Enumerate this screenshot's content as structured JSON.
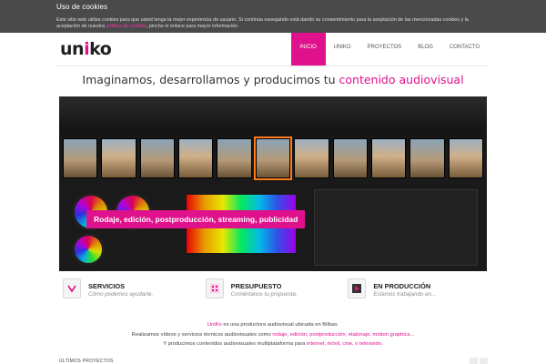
{
  "cookie": {
    "title": "Uso de cookies",
    "text_before": "Este sitio web utiliza cookies para que usted tenga la mejor experiencia de usuario. Si continúa navegando está dando su consentimiento para la aceptación de las mencionadas cookies y la aceptación de nuestra ",
    "link": "política de cookies",
    "text_after": ", pinche el enlace para mayor información."
  },
  "header": {
    "logo_pre": "un",
    "logo_i": "i",
    "logo_post": "ko",
    "nav": [
      "INICIO",
      "UNIKO",
      "PROYECTOS",
      "BLOG",
      "CONTACTO"
    ]
  },
  "tagline": {
    "main": "Imaginamos, desarrollamos y producimos tu ",
    "highlight": "contenido audiovisual"
  },
  "hero": {
    "caption": "Rodaje, edición, postproducción, streaming, publicidad"
  },
  "services": [
    {
      "title": "SERVICIOS",
      "subtitle": "Cómo podemos ayudarte.",
      "icon": "tag-icon"
    },
    {
      "title": "PRESUPUESTO",
      "subtitle": "Coméntanos tu propuesta.",
      "icon": "calculator-icon"
    },
    {
      "title": "EN PRODUCCIÓN",
      "subtitle": "Estamos trabajando en...",
      "icon": "film-icon"
    }
  ],
  "about": {
    "l1_brand": "UniKo",
    "l1_rest": " es una productora audiovisual ubicada en Bilbao.",
    "l2_pre": "Realizamos vídeos y servicios técnicos audiovisuales como ",
    "l2_items": "rodaje, edición, postproducción, etalonaje, motion graphics",
    "l2_post": "...",
    "l3_pre": "Y producimos contenidos audiovisuales multiplataforma  para ",
    "l3_items": "internet, móvil, cine, o televisión",
    "l3_post": "."
  },
  "projects": {
    "title": "ÚLTIMOS PROYECTOS"
  },
  "colors": {
    "accent": "#e0118c",
    "cookie_bg": "#4a4a4a"
  }
}
